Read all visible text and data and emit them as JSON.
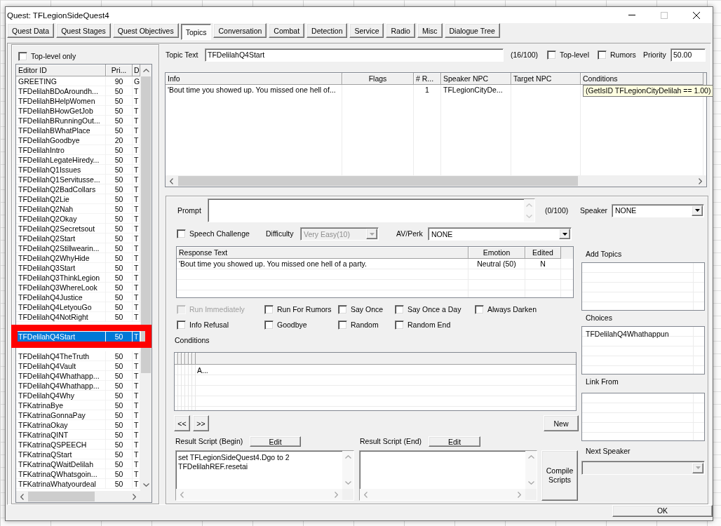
{
  "window": {
    "title": "Quest: TFLegionSideQuest4",
    "maximize_disabled": true
  },
  "tabs": [
    {
      "label": "Quest Data",
      "selected": false
    },
    {
      "label": "Quest Stages",
      "selected": false
    },
    {
      "label": "Quest Objectives",
      "selected": false
    },
    {
      "label": "Topics",
      "selected": true
    },
    {
      "label": "Conversation",
      "selected": false
    },
    {
      "label": "Combat",
      "selected": false
    },
    {
      "label": "Detection",
      "selected": false
    },
    {
      "label": "Service",
      "selected": false
    },
    {
      "label": "Radio",
      "selected": false
    },
    {
      "label": "Misc",
      "selected": false
    },
    {
      "label": "Dialogue Tree",
      "selected": false
    }
  ],
  "topic_list": {
    "top_level_only": {
      "label": "Top-level only",
      "checked": false
    },
    "columns": [
      "Editor ID",
      "Pri...",
      "D"
    ],
    "highlight_selected": true,
    "rows": [
      {
        "editor_id": "GREETING",
        "priority": "90",
        "column_3": "G",
        "selected": false
      },
      {
        "editor_id": "TFDelilahBDoAroundh...",
        "priority": "50",
        "column_3": "T",
        "selected": false
      },
      {
        "editor_id": "TFDelilahBHelpWomen",
        "priority": "50",
        "column_3": "T",
        "selected": false
      },
      {
        "editor_id": "TFDelilahBHowGetJob",
        "priority": "50",
        "column_3": "T",
        "selected": false
      },
      {
        "editor_id": "TFDelilahBRunningOut...",
        "priority": "50",
        "column_3": "T",
        "selected": false
      },
      {
        "editor_id": "TFDelilahBWhatPlace",
        "priority": "50",
        "column_3": "T",
        "selected": false
      },
      {
        "editor_id": "TFDelilahGoodbye",
        "priority": "20",
        "column_3": "T",
        "selected": false
      },
      {
        "editor_id": "TFDelilahIntro",
        "priority": "50",
        "column_3": "T",
        "selected": false
      },
      {
        "editor_id": "TFDelilahLegateHiredy...",
        "priority": "50",
        "column_3": "T",
        "selected": false
      },
      {
        "editor_id": "TFDelilahQ1Issues",
        "priority": "50",
        "column_3": "T",
        "selected": false
      },
      {
        "editor_id": "TFDelilahQ1Servitusse...",
        "priority": "50",
        "column_3": "T",
        "selected": false
      },
      {
        "editor_id": "TFDelilahQ2BadCollars",
        "priority": "50",
        "column_3": "T",
        "selected": false
      },
      {
        "editor_id": "TFDelilahQ2Lie",
        "priority": "50",
        "column_3": "T",
        "selected": false
      },
      {
        "editor_id": "TFDelilahQ2Nah",
        "priority": "50",
        "column_3": "T",
        "selected": false
      },
      {
        "editor_id": "TFDelilahQ2Okay",
        "priority": "50",
        "column_3": "T",
        "selected": false
      },
      {
        "editor_id": "TFDelilahQ2Secretsout",
        "priority": "50",
        "column_3": "T",
        "selected": false
      },
      {
        "editor_id": "TFDelilahQ2Start",
        "priority": "50",
        "column_3": "T",
        "selected": false
      },
      {
        "editor_id": "TFDelilahQ2Stillwearin...",
        "priority": "50",
        "column_3": "T",
        "selected": false
      },
      {
        "editor_id": "TFDelilahQ2WhyHide",
        "priority": "50",
        "column_3": "T",
        "selected": false
      },
      {
        "editor_id": "TFDelilahQ3Start",
        "priority": "50",
        "column_3": "T",
        "selected": false
      },
      {
        "editor_id": "TFDelilahQ3ThinkLegion",
        "priority": "50",
        "column_3": "T",
        "selected": false
      },
      {
        "editor_id": "TFDelilahQ3WhereLook",
        "priority": "50",
        "column_3": "T",
        "selected": false
      },
      {
        "editor_id": "TFDelilahQ4Justice",
        "priority": "50",
        "column_3": "T",
        "selected": false
      },
      {
        "editor_id": "TFDelilahQ4LetyouGo",
        "priority": "50",
        "column_3": "T",
        "selected": false
      },
      {
        "editor_id": "TFDelilahQ4NotRight",
        "priority": "50",
        "column_3": "T",
        "selected": false
      },
      {
        "editor_id": "TFDelilahQ4Start",
        "priority": "50",
        "column_3": "T",
        "selected": true
      },
      {
        "editor_id": "TFDelilahQ4TheTruth",
        "priority": "50",
        "column_3": "T",
        "selected": false
      },
      {
        "editor_id": "TFDelilahQ4Vault",
        "priority": "50",
        "column_3": "T",
        "selected": false
      },
      {
        "editor_id": "TFDelilahQ4Whathapp...",
        "priority": "50",
        "column_3": "T",
        "selected": false
      },
      {
        "editor_id": "TFDelilahQ4Whathapp...",
        "priority": "50",
        "column_3": "T",
        "selected": false
      },
      {
        "editor_id": "TFDelilahQ4Why",
        "priority": "50",
        "column_3": "T",
        "selected": false
      },
      {
        "editor_id": "TFKatrinaBye",
        "priority": "50",
        "column_3": "T",
        "selected": false
      },
      {
        "editor_id": "TFKatrinaGonnaPay",
        "priority": "50",
        "column_3": "T",
        "selected": false
      },
      {
        "editor_id": "TFKatrinaOkay",
        "priority": "50",
        "column_3": "T",
        "selected": false
      },
      {
        "editor_id": "TFKatrinaQINT",
        "priority": "50",
        "column_3": "T",
        "selected": false
      },
      {
        "editor_id": "TFKatrinaQSPEECH",
        "priority": "50",
        "column_3": "T",
        "selected": false
      },
      {
        "editor_id": "TFKatrinaQStart",
        "priority": "50",
        "column_3": "T",
        "selected": false
      },
      {
        "editor_id": "TFKatrinaQWaitDelilah",
        "priority": "50",
        "column_3": "T",
        "selected": false
      },
      {
        "editor_id": "TFKatrinaQWhatsgoin...",
        "priority": "50",
        "column_3": "T",
        "selected": false
      },
      {
        "editor_id": "TFKatrinaWhatyourdeal",
        "priority": "50",
        "column_3": "T",
        "selected": false
      }
    ]
  },
  "topic": {
    "label": "Topic Text",
    "value": "TFDelilahQ4Start",
    "count": "(16/100)",
    "top_level": {
      "label": "Top-level",
      "checked": false
    },
    "rumors": {
      "label": "Rumors",
      "checked": false
    },
    "priority_label": "Priority",
    "priority": "50.00"
  },
  "info_table": {
    "columns": [
      "Info",
      "Flags",
      "# R...",
      "Speaker NPC",
      "Target NPC",
      "Conditions"
    ],
    "rows": [
      {
        "info": "'Bout time you showed up. You missed one hell of...",
        "responses": "1",
        "speaker_npc": "TFLegionCityDe...",
        "conditions": "(GetIsID TFLegionCityDelilah == 1.00)"
      }
    ]
  },
  "info_editor": {
    "prompt": {
      "label": "Prompt",
      "count": "(0/100)"
    },
    "speaker": {
      "label": "Speaker",
      "value": "NONE"
    },
    "speech_challenge": {
      "label": "Speech Challenge",
      "checked": false
    },
    "difficulty": {
      "label": "Difficulty",
      "value": "Very Easy(10)",
      "disabled": true
    },
    "av_perk": {
      "label": "AV/Perk",
      "value": "NONE"
    },
    "responses": {
      "columns": [
        "Response Text",
        "Emotion",
        "Edited"
      ],
      "rows": [
        {
          "text": "'Bout time you showed up. You missed one hell of a party.",
          "emotion": "Neutral (50)",
          "edited": "N"
        }
      ]
    },
    "flags": [
      {
        "label": "Run Immediately",
        "checked": false,
        "disabled": true
      },
      {
        "label": "Run For Rumors",
        "checked": false,
        "disabled": false
      },
      {
        "label": "Say Once",
        "checked": false,
        "disabled": false
      },
      {
        "label": "Say Once a Day",
        "checked": false,
        "disabled": false
      },
      {
        "label": "Always Darken",
        "checked": false,
        "disabled": false
      },
      {
        "label": "Info Refusal",
        "checked": false,
        "disabled": false
      },
      {
        "label": "Goodbye",
        "checked": false,
        "disabled": false
      },
      {
        "label": "Random",
        "checked": false,
        "disabled": false
      },
      {
        "label": "Random End",
        "checked": false,
        "disabled": false
      }
    ],
    "conditions": {
      "label": "Conditions",
      "rows": [
        {
          "column_7": "A..."
        }
      ]
    },
    "prev_button": "<<",
    "next_button": ">>",
    "new_button": "New",
    "result_begin": {
      "label": "Result Script (Begin)",
      "edit_button": "Edit",
      "lines": [
        "set TFLegionSideQuest4.Dgo to 2",
        "TFDelilahREF.resetai"
      ]
    },
    "result_end": {
      "label": "Result Script (End)",
      "edit_button": "Edit"
    },
    "compile_button": "Compile Scripts",
    "add_topics": {
      "label": "Add Topics"
    },
    "choices": {
      "label": "Choices",
      "items": [
        "TFDelilahQ4Whathappun"
      ]
    },
    "link_from": {
      "label": "Link From"
    },
    "next_speaker": {
      "label": "Next Speaker",
      "disabled": true
    }
  },
  "ok_button": "OK"
}
